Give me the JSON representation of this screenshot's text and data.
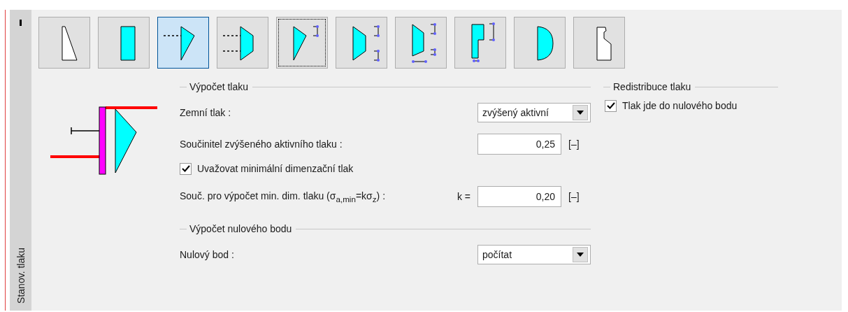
{
  "side_tab": {
    "label": "Stanov. tlaku"
  },
  "toolbar": [
    {
      "kind": "wedge",
      "selected": false,
      "focused": false
    },
    {
      "kind": "rectangle",
      "selected": false,
      "focused": false
    },
    {
      "kind": "triangle",
      "selected": true,
      "focused": false
    },
    {
      "kind": "trapezoid",
      "selected": false,
      "focused": false
    },
    {
      "kind": "triangle-dims",
      "selected": false,
      "focused": true
    },
    {
      "kind": "trapezoid-dims",
      "selected": false,
      "focused": false
    },
    {
      "kind": "trapezoid-base",
      "selected": false,
      "focused": false
    },
    {
      "kind": "stepped",
      "selected": false,
      "focused": false
    },
    {
      "kind": "semicircle",
      "selected": false,
      "focused": false
    },
    {
      "kind": "profile",
      "selected": false,
      "focused": false
    }
  ],
  "pressure_section": {
    "title": "Výpočet tlaku",
    "earth_pressure": {
      "label": "Zemní tlak :",
      "value": "zvýšený aktivní"
    },
    "coefficient": {
      "label": "Součinitel zvýšeného aktivního tlaku :",
      "value": "0,25",
      "unit": "[–]"
    },
    "min_pressure": {
      "label": "Uvažovat minimální dimenzační tlak",
      "checked": true
    },
    "min_coefficient": {
      "label": "Souč. pro výpočet min. dim. tlaku (σ$_{a,min}$=kσ$_{z}$) :",
      "prefix": "k =",
      "value": "0,20",
      "unit": "[–]"
    }
  },
  "zero_point_section": {
    "title": "Výpočet nulového bodu",
    "field": {
      "label": "Nulový bod :",
      "value": "počítat"
    }
  },
  "redistribution_section": {
    "title": "Redistribuce tlaku",
    "checkbox": {
      "label": "Tlak jde do nulového bodu",
      "checked": true
    }
  }
}
